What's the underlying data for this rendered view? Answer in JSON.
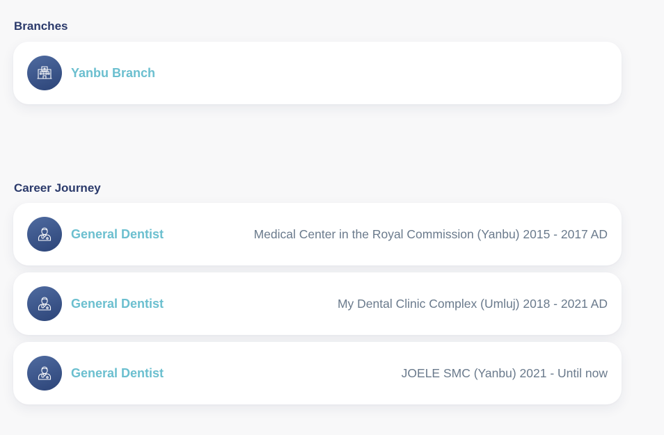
{
  "branches": {
    "heading": "Branches",
    "items": [
      {
        "name": "Yanbu Branch",
        "icon": "hospital-icon"
      }
    ]
  },
  "career": {
    "heading": "Career Journey",
    "items": [
      {
        "role": "General Dentist",
        "detail": "Medical Center in the Royal Commission (Yanbu) 2015 - 2017 AD",
        "icon": "doctor-icon"
      },
      {
        "role": "General Dentist",
        "detail": "My Dental Clinic Complex (Umluj) 2018 - 2021 AD",
        "icon": "doctor-icon"
      },
      {
        "role": "General Dentist",
        "detail": "JOELE SMC (Yanbu) 2021 - Until now",
        "icon": "doctor-icon"
      }
    ]
  },
  "colors": {
    "heading": "#2b3a6b",
    "accent": "#6bbfcf",
    "avatar": "#3d5588",
    "detail_text": "#6a7a8c",
    "background": "#f8f8f9"
  }
}
